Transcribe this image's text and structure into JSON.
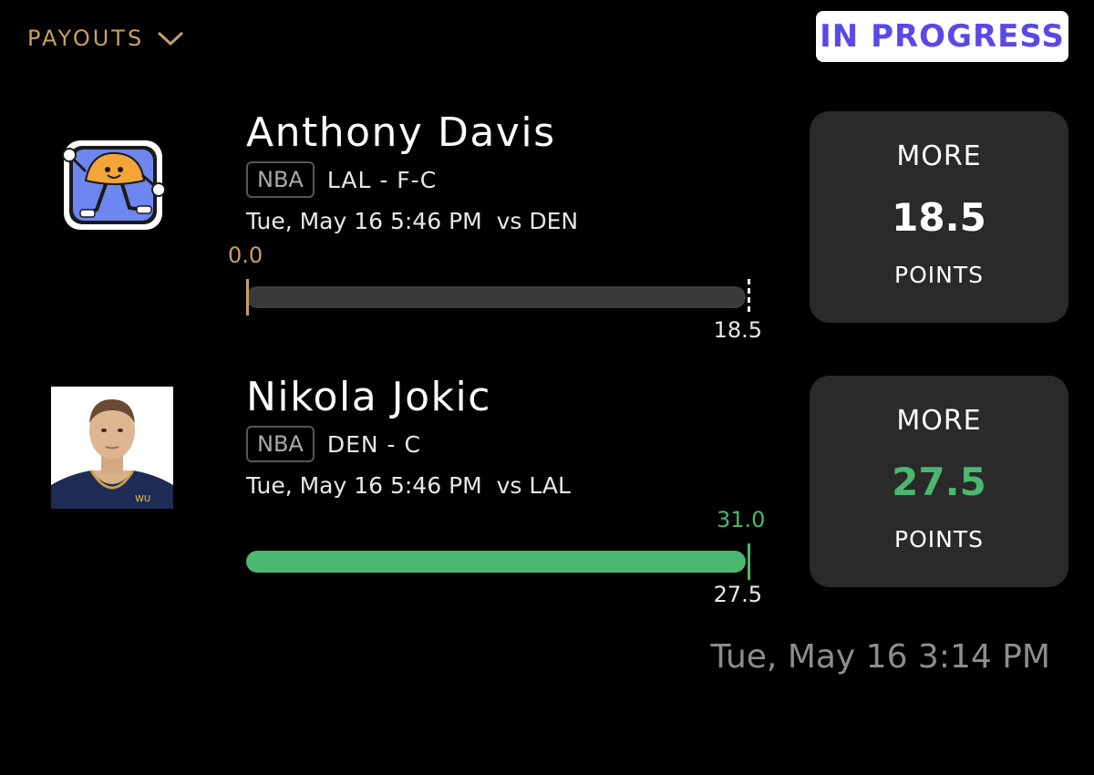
{
  "header": {
    "payouts_label": "PAYOUTS",
    "status": "IN PROGRESS"
  },
  "picks": [
    {
      "player": "Anthony Davis",
      "league": "NBA",
      "team_position": "LAL - F-C",
      "game_time": "Tue, May 16 5:46 PM  vs DEN",
      "current": "0.0",
      "target": "18.5",
      "progress": 0,
      "direction": "MORE",
      "line": "18.5",
      "stat": "POINTS",
      "avatar_icon": "taco-mascot-icon"
    },
    {
      "player": "Nikola Jokic",
      "league": "NBA",
      "team_position": "DEN - C",
      "game_time": "Tue, May 16 5:46 PM  vs LAL",
      "current": "31.0",
      "target": "27.5",
      "progress": 1,
      "direction": "MORE",
      "line": "27.5",
      "stat": "POINTS",
      "avatar_icon": "player-headshot"
    }
  ],
  "timestamp": "Tue, May 16 3:14 PM",
  "colors": {
    "accent_gold": "#c9a063",
    "status_purple": "#5a49e6",
    "success_green": "#4ab86f",
    "card_bg": "#2a2a2a"
  }
}
